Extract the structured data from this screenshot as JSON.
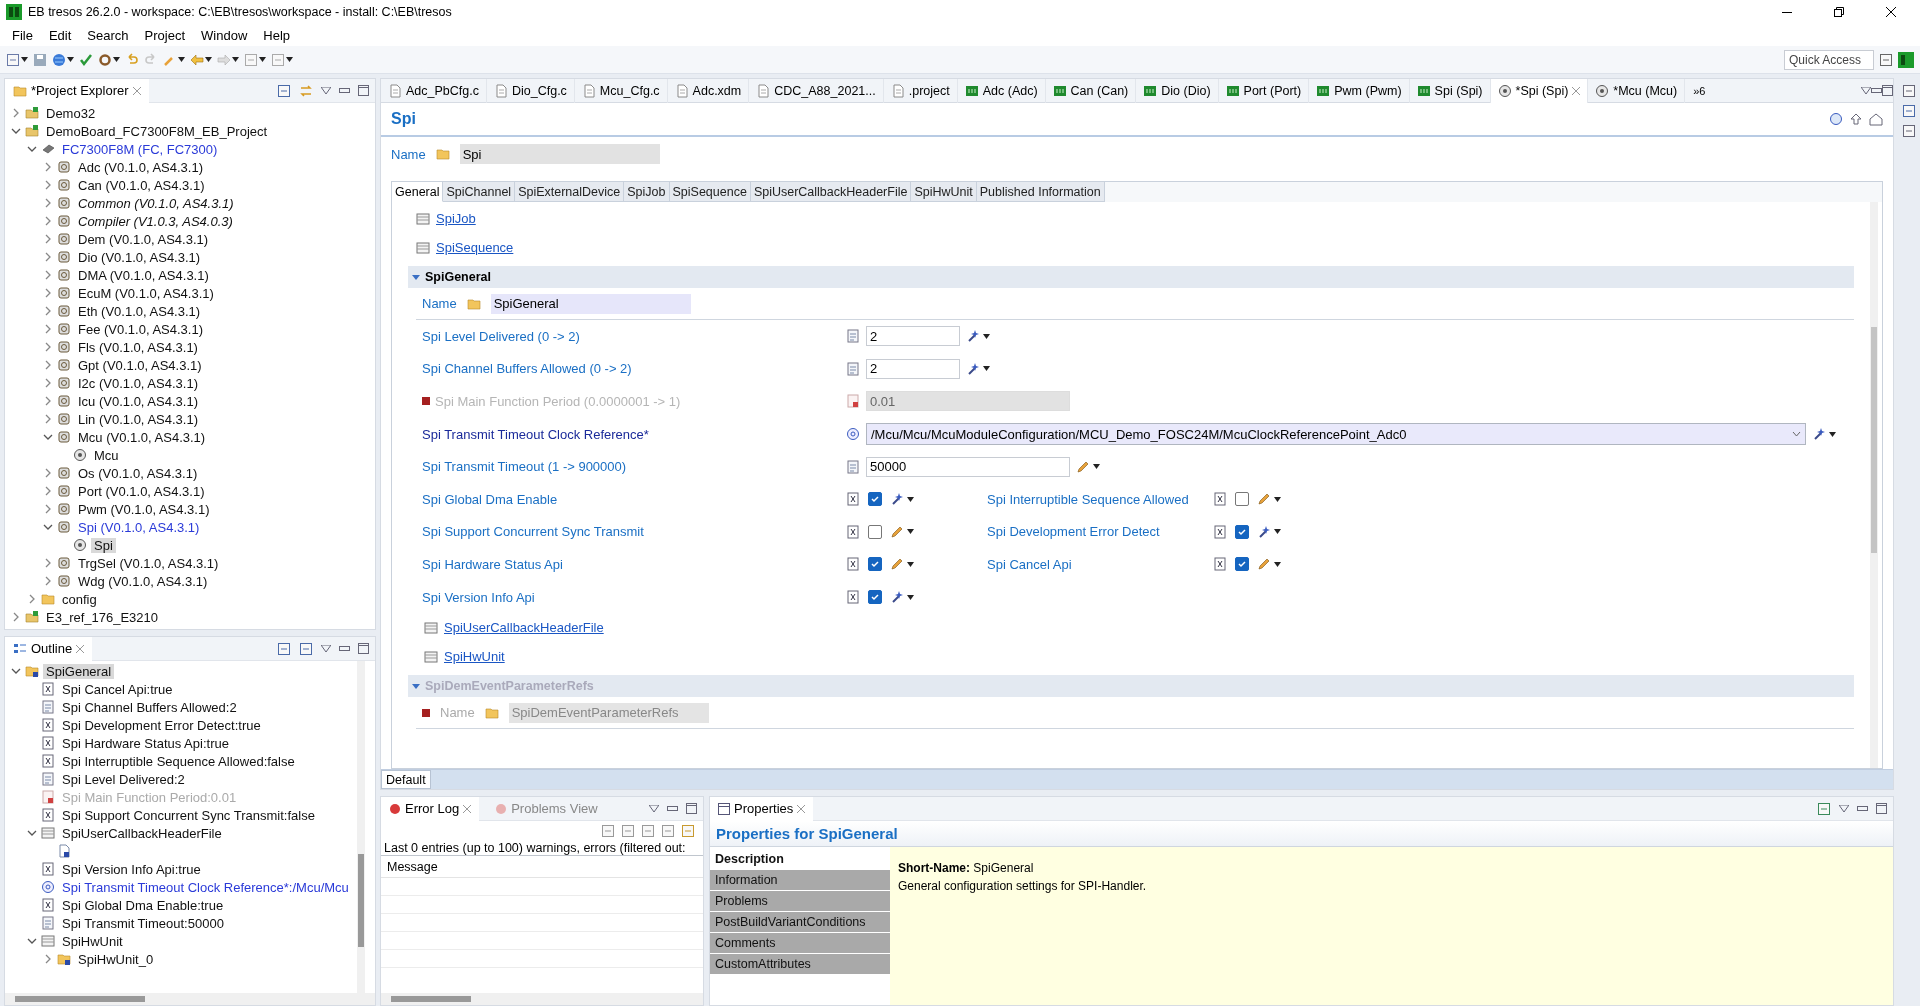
{
  "window": {
    "title": "EB tresos 26.2.0 - workspace: C:\\EB\\tresos\\workspace - install: C:\\EB\\tresos"
  },
  "menu": [
    "File",
    "Edit",
    "Search",
    "Project",
    "Window",
    "Help"
  ],
  "quick_access": {
    "placeholder": "Quick Access"
  },
  "project_explorer": {
    "title": "*Project Explorer",
    "items": [
      {
        "label": "Demo32",
        "kind": "project",
        "active": false,
        "selected": false,
        "expanded": false
      },
      {
        "label": "DemoBoard_FC7300F8M_EB_Project",
        "kind": "project",
        "active": false,
        "selected": false,
        "expanded": true,
        "children": [
          {
            "label": "FC7300F8M (FC, FC7300)",
            "kind": "chip",
            "active": true,
            "selected": false,
            "expanded": true,
            "children": [
              {
                "label": "Adc (V0.1.0, AS4.3.1)",
                "kind": "module",
                "active": false,
                "selected": false,
                "expanded": false
              },
              {
                "label": "Can (V0.1.0, AS4.3.1)",
                "kind": "module",
                "active": false,
                "selected": false,
                "expanded": false
              },
              {
                "label": "Common (V0.1.0, AS4.3.1)",
                "kind": "library",
                "active": false,
                "selected": false,
                "expanded": false
              },
              {
                "label": "Compiler (V1.0.3, AS4.0.3)",
                "kind": "library",
                "active": false,
                "selected": false,
                "expanded": false
              },
              {
                "label": "Dem (V0.1.0, AS4.3.1)",
                "kind": "module",
                "active": false,
                "selected": false,
                "expanded": false
              },
              {
                "label": "Dio (V0.1.0, AS4.3.1)",
                "kind": "module",
                "active": false,
                "selected": false,
                "expanded": false
              },
              {
                "label": "DMA (V0.1.0, AS4.3.1)",
                "kind": "module",
                "active": false,
                "selected": false,
                "expanded": false
              },
              {
                "label": "EcuM (V0.1.0, AS4.3.1)",
                "kind": "module",
                "active": false,
                "selected": false,
                "expanded": false
              },
              {
                "label": "Eth (V0.1.0, AS4.3.1)",
                "kind": "module",
                "active": false,
                "selected": false,
                "expanded": false
              },
              {
                "label": "Fee (V0.1.0, AS4.3.1)",
                "kind": "module",
                "active": false,
                "selected": false,
                "expanded": false
              },
              {
                "label": "Fls (V0.1.0, AS4.3.1)",
                "kind": "module",
                "active": false,
                "selected": false,
                "expanded": false
              },
              {
                "label": "Gpt (V0.1.0, AS4.3.1)",
                "kind": "module",
                "active": false,
                "selected": false,
                "expanded": false
              },
              {
                "label": "I2c (V0.1.0, AS4.3.1)",
                "kind": "module",
                "active": false,
                "selected": false,
                "expanded": false
              },
              {
                "label": "Icu (V0.1.0, AS4.3.1)",
                "kind": "module",
                "active": false,
                "selected": false,
                "expanded": false
              },
              {
                "label": "Lin (V0.1.0, AS4.3.1)",
                "kind": "module",
                "active": false,
                "selected": false,
                "expanded": false
              },
              {
                "label": "Mcu (V0.1.0, AS4.3.1)",
                "kind": "module",
                "active": false,
                "selected": false,
                "expanded": true,
                "children": [
                  {
                    "label": "Mcu",
                    "kind": "config",
                    "active": false,
                    "selected": false
                  }
                ]
              },
              {
                "label": "Os (V0.1.0, AS4.3.1)",
                "kind": "module",
                "active": false,
                "selected": false,
                "expanded": false
              },
              {
                "label": "Port (V0.1.0, AS4.3.1)",
                "kind": "module",
                "active": false,
                "selected": false,
                "expanded": false
              },
              {
                "label": "Pwm (V0.1.0, AS4.3.1)",
                "kind": "module",
                "active": false,
                "selected": false,
                "expanded": false
              },
              {
                "label": "Spi (V0.1.0, AS4.3.1)",
                "kind": "module",
                "active": true,
                "selected": false,
                "expanded": true,
                "children": [
                  {
                    "label": "Spi",
                    "kind": "config",
                    "active": false,
                    "selected": true
                  }
                ]
              },
              {
                "label": "TrgSel (V0.1.0, AS4.3.1)",
                "kind": "module",
                "active": false,
                "selected": false,
                "expanded": false
              },
              {
                "label": "Wdg (V0.1.0, AS4.3.1)",
                "kind": "module",
                "active": false,
                "selected": false,
                "expanded": false
              }
            ]
          },
          {
            "label": "config",
            "kind": "folder",
            "active": false,
            "selected": false,
            "expanded": false
          }
        ]
      },
      {
        "label": "E3_ref_176_E3210",
        "kind": "project",
        "active": false,
        "selected": false,
        "expanded": false
      }
    ]
  },
  "outline": {
    "title": "Outline",
    "items": [
      {
        "label": "SpiGeneral",
        "kind": "container",
        "selected": true,
        "expanded": true,
        "children": [
          {
            "label": "Spi Cancel Api:true",
            "kind": "bool",
            "selected": false
          },
          {
            "label": "Spi Channel Buffers Allowed:2",
            "kind": "number",
            "selected": false
          },
          {
            "label": "Spi Development Error Detect:true",
            "kind": "bool",
            "selected": false
          },
          {
            "label": "Spi Hardware Status Api:true",
            "kind": "bool",
            "selected": false
          },
          {
            "label": "Spi Interruptible Sequence Allowed:false",
            "kind": "bool",
            "selected": false
          },
          {
            "label": "Spi Level Delivered:2",
            "kind": "number",
            "selected": false
          },
          {
            "label": "Spi Main Function Period:0.01",
            "kind": "disabled",
            "selected": false
          },
          {
            "label": "Spi Support Concurrent Sync Transmit:false",
            "kind": "bool",
            "selected": false
          },
          {
            "label": "SpiUserCallbackHeaderFile",
            "kind": "list",
            "selected": false,
            "expanded": true,
            "children": [
              {
                "kind": "file"
              }
            ]
          },
          {
            "label": "Spi Version Info Api:true",
            "kind": "bool",
            "selected": false
          },
          {
            "label": "Spi Transmit Timeout Clock Reference*:/Mcu/Mcu",
            "kind": "reference",
            "selected": false
          },
          {
            "label": "Spi Global Dma Enable:true",
            "kind": "bool",
            "selected": false
          },
          {
            "label": "Spi Transmit Timeout:50000",
            "kind": "number",
            "selected": false
          },
          {
            "label": "SpiHwUnit",
            "kind": "list",
            "selected": false,
            "expanded": true,
            "children": [
              {
                "label": "SpiHwUnit_0",
                "kind": "container",
                "selected": false,
                "expanded": false
              }
            ]
          }
        ]
      }
    ]
  },
  "editor_tabs": [
    {
      "label": "Adc_PbCfg.c",
      "kind": "file",
      "selected": false
    },
    {
      "label": "Dio_Cfg.c",
      "kind": "file",
      "selected": false
    },
    {
      "label": "Mcu_Cfg.c",
      "kind": "file",
      "selected": false
    },
    {
      "label": "Adc.xdm",
      "kind": "file",
      "selected": false
    },
    {
      "label": "CDC_A88_2021...",
      "kind": "file",
      "selected": false
    },
    {
      "label": ".project",
      "kind": "file",
      "selected": false
    },
    {
      "label": "Adc (Adc)",
      "kind": "module",
      "selected": false
    },
    {
      "label": "Can (Can)",
      "kind": "module",
      "selected": false
    },
    {
      "label": "Dio (Dio)",
      "kind": "module",
      "selected": false
    },
    {
      "label": "Port (Port)",
      "kind": "module",
      "selected": false
    },
    {
      "label": "Pwm (Pwm)",
      "kind": "module",
      "selected": false
    },
    {
      "label": "Spi (Spi)",
      "kind": "module",
      "selected": false
    },
    {
      "label": "*Spi (Spi)",
      "kind": "config",
      "selected": true
    },
    {
      "label": "*Mcu (Mcu)",
      "kind": "config",
      "selected": false
    }
  ],
  "more_tabs": "»6",
  "editor": {
    "title": "Spi",
    "name_label": "Name",
    "name_value": "Spi",
    "subtabs": [
      {
        "label": "General",
        "selected": true
      },
      {
        "label": "SpiChannel",
        "selected": false
      },
      {
        "label": "SpiExternalDevice",
        "selected": false
      },
      {
        "label": "SpiJob",
        "selected": false
      },
      {
        "label": "SpiSequence",
        "selected": false
      },
      {
        "label": "SpiUserCallbackHeaderFile",
        "selected": false
      },
      {
        "label": "SpiHwUnit",
        "selected": false
      },
      {
        "label": "Published Information",
        "selected": false
      }
    ],
    "content": [
      {
        "kind": "link",
        "label": "SpiJob"
      },
      {
        "kind": "link",
        "label": "SpiSequence"
      },
      {
        "kind": "section",
        "title": "SpiGeneral",
        "disabled": false,
        "expanded": true,
        "name_label": "Name",
        "name_value": "SpiGeneral",
        "parameters": [
          {
            "kind": "number",
            "label": "Spi Level Delivered (0 -> 2)",
            "value": "2",
            "disabled": false,
            "calculated": true
          },
          {
            "kind": "number",
            "label": "Spi Channel Buffers Allowed (0 -> 2)",
            "value": "2",
            "disabled": false,
            "calculated": true
          },
          {
            "kind": "number",
            "label": "Spi Main Function Period (0.0000001 -> 1)",
            "value": "0.01",
            "disabled": true
          },
          {
            "kind": "reference",
            "label": "Spi Transmit Timeout Clock Reference*",
            "value": "/Mcu/Mcu/McuModuleConfiguration/MCU_Demo_FOSC24M/McuClockReferencePoint_Adc0",
            "disabled": false,
            "calculated": true
          },
          {
            "kind": "number",
            "label": "Spi Transmit Timeout (1 -> 900000)",
            "value": "50000",
            "disabled": false,
            "calculated": false
          },
          {
            "kind": "bools",
            "items": [
              {
                "label": "Spi Global Dma Enable",
                "checked": true,
                "calculated": true
              },
              {
                "label": "Spi Interruptible Sequence Allowed",
                "checked": false,
                "calculated": false
              }
            ]
          },
          {
            "kind": "bools",
            "items": [
              {
                "label": "Spi Support Concurrent Sync Transmit",
                "checked": false,
                "calculated": false
              },
              {
                "label": "Spi Development Error Detect",
                "checked": true,
                "calculated": true
              }
            ]
          },
          {
            "kind": "bools",
            "items": [
              {
                "label": "Spi Hardware Status Api",
                "checked": true,
                "calculated": false
              },
              {
                "label": "Spi Cancel Api",
                "checked": true,
                "calculated": false
              }
            ]
          },
          {
            "kind": "bools",
            "items": [
              {
                "label": "Spi Version Info Api",
                "checked": true,
                "calculated": true
              }
            ]
          },
          {
            "kind": "link",
            "label": "SpiUserCallbackHeaderFile"
          },
          {
            "kind": "link",
            "label": "SpiHwUnit"
          }
        ]
      },
      {
        "kind": "section",
        "title": "SpiDemEventParameterRefs",
        "disabled": true,
        "expanded": true,
        "name_label": "Name",
        "name_value": "SpiDemEventParameterRefs"
      }
    ]
  },
  "mode_bar": "Default",
  "error_log": {
    "tabs": [
      {
        "label": "Error Log",
        "selected": true
      },
      {
        "label": "Problems View",
        "selected": false
      }
    ],
    "summary": "Last 0 entries (up to 100) warnings, errors (filtered out:",
    "column": "Message"
  },
  "properties": {
    "tab": "Properties",
    "heading": "Properties for SpiGeneral",
    "sections": [
      {
        "label": "Description",
        "selected": true
      },
      {
        "label": "Information",
        "selected": false
      },
      {
        "label": "Problems",
        "selected": false
      },
      {
        "label": "PostBuildVariantConditions",
        "selected": false
      },
      {
        "label": "Comments",
        "selected": false
      },
      {
        "label": "CustomAttributes",
        "selected": false
      }
    ],
    "lines": [
      "**Short-Name:** SpiGeneral",
      "General configuration settings for SPI-Handler."
    ]
  }
}
